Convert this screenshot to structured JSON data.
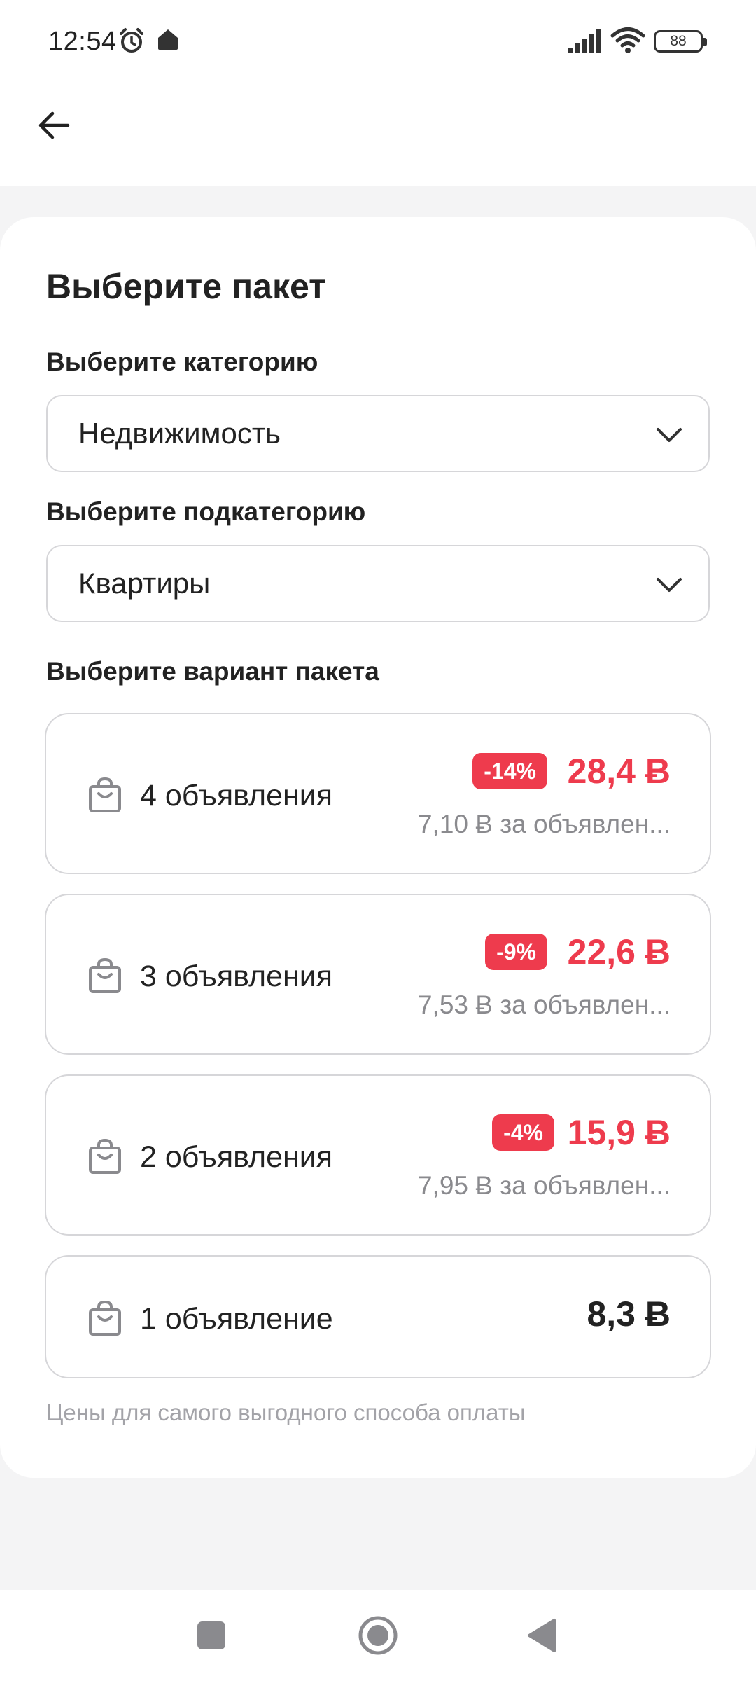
{
  "status_bar": {
    "time": "12:54",
    "battery": "88",
    "icons": [
      "alarm-icon",
      "home-notification-icon",
      "signal-icon",
      "wifi-icon",
      "battery-icon"
    ]
  },
  "header": {
    "back_icon": "arrow-left-icon"
  },
  "page": {
    "title": "Выберите пакет",
    "category_label": "Выберите категорию",
    "category_value": "Недвижимость",
    "subcategory_label": "Выберите подкатегорию",
    "subcategory_value": "Квартиры",
    "variant_label": "Выберите вариант пакета",
    "packages": [
      {
        "label": "4 объявления",
        "discount": "-14%",
        "price": "28,4 Ƀ",
        "unit_price": "7,10 Ƀ за объявлен..."
      },
      {
        "label": "3 объявления",
        "discount": "-9%",
        "price": "22,6 Ƀ",
        "unit_price": "7,53 Ƀ за объявлен..."
      },
      {
        "label": "2 объявления",
        "discount": "-4%",
        "price": "15,9 Ƀ",
        "unit_price": "7,95 Ƀ за объявлен..."
      },
      {
        "label": "1 объявление",
        "price": "8,3 Ƀ"
      }
    ],
    "footnote": "Цены для самого выгодного способа оплаты"
  },
  "colors": {
    "accent_red": "#ee3b4d",
    "background_grey": "#f4f4f5",
    "border": "#d6d6d9"
  },
  "nav_bar": {
    "icons": [
      "recent-apps-icon",
      "home-icon",
      "back-icon"
    ]
  }
}
